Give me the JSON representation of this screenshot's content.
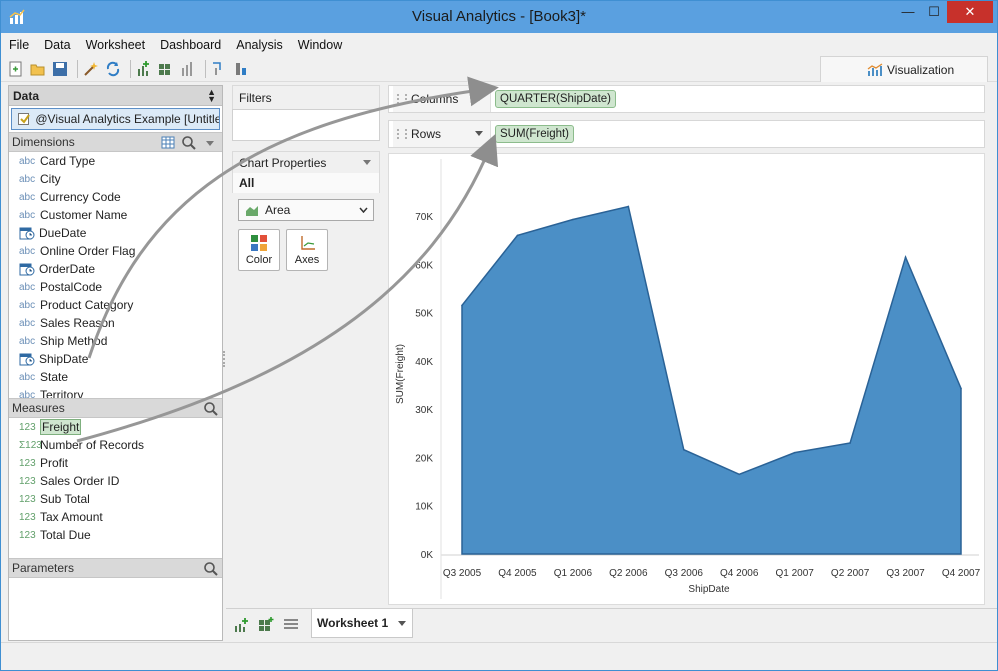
{
  "window": {
    "title": "Visual Analytics - [Book3]*",
    "close_label": "✕",
    "min_label": "—",
    "max_label": "☐"
  },
  "menu": [
    "File",
    "Data",
    "Worksheet",
    "Dashboard",
    "Analysis",
    "Window"
  ],
  "toolbar": {
    "visualization_tab": "Visualization"
  },
  "data_pane": {
    "header": "Data",
    "datasource": "@Visual Analytics Example [Untitle...",
    "dimensions_header": "Dimensions",
    "dimensions": [
      {
        "type": "abc",
        "name": "Card Type"
      },
      {
        "type": "abc",
        "name": "City"
      },
      {
        "type": "abc",
        "name": "Currency Code"
      },
      {
        "type": "abc",
        "name": "Customer Name"
      },
      {
        "type": "date",
        "name": "DueDate"
      },
      {
        "type": "abc",
        "name": "Online Order Flag"
      },
      {
        "type": "date",
        "name": "OrderDate"
      },
      {
        "type": "abc",
        "name": "PostalCode"
      },
      {
        "type": "abc",
        "name": "Product Category"
      },
      {
        "type": "abc",
        "name": "Sales Reason"
      },
      {
        "type": "abc",
        "name": "Ship Method"
      },
      {
        "type": "date",
        "name": "ShipDate"
      },
      {
        "type": "abc",
        "name": "State"
      },
      {
        "type": "abc",
        "name": "Territory"
      }
    ],
    "measures_header": "Measures",
    "measures": [
      {
        "type": "123",
        "name": "Freight"
      },
      {
        "type": "Σ123",
        "name": "Number of Records"
      },
      {
        "type": "123",
        "name": "Profit"
      },
      {
        "type": "123",
        "name": "Sales Order ID"
      },
      {
        "type": "123",
        "name": "Sub Total"
      },
      {
        "type": "123",
        "name": "Tax Amount"
      },
      {
        "type": "123",
        "name": "Total Due"
      }
    ],
    "parameters_header": "Parameters"
  },
  "filters": {
    "header": "Filters"
  },
  "chart_properties": {
    "header": "Chart Properties",
    "all_label": "All",
    "mark_type": "Area",
    "color_label": "Color",
    "axes_label": "Axes"
  },
  "shelves": {
    "columns_label": "Columns",
    "columns_pill": "QUARTER(ShipDate)",
    "rows_label": "Rows",
    "rows_pill": "SUM(Freight)"
  },
  "sheet_tab": {
    "label": "Worksheet 1"
  },
  "colors": {
    "accent": "#5aa0e0",
    "area_fill": "#4b8fc6",
    "area_stroke": "#2a6296",
    "pill": "#cfe6cf"
  },
  "chart_data": {
    "type": "area",
    "xlabel": "ShipDate",
    "ylabel": "SUM(Freight)",
    "categories": [
      "Q3 2005",
      "Q4 2005",
      "Q1 2006",
      "Q2 2006",
      "Q3 2006",
      "Q4 2006",
      "Q1 2007",
      "Q2 2007",
      "Q3 2007",
      "Q4 2007"
    ],
    "values": [
      51500,
      66000,
      69300,
      72000,
      21600,
      16500,
      21000,
      23000,
      61500,
      34300
    ],
    "ylim": [
      0,
      75000
    ],
    "yticks": [
      0,
      10000,
      20000,
      30000,
      40000,
      50000,
      60000,
      70000
    ],
    "ytick_labels": [
      "0K",
      "10K",
      "20K",
      "30K",
      "40K",
      "50K",
      "60K",
      "70K"
    ],
    "grid": false
  }
}
